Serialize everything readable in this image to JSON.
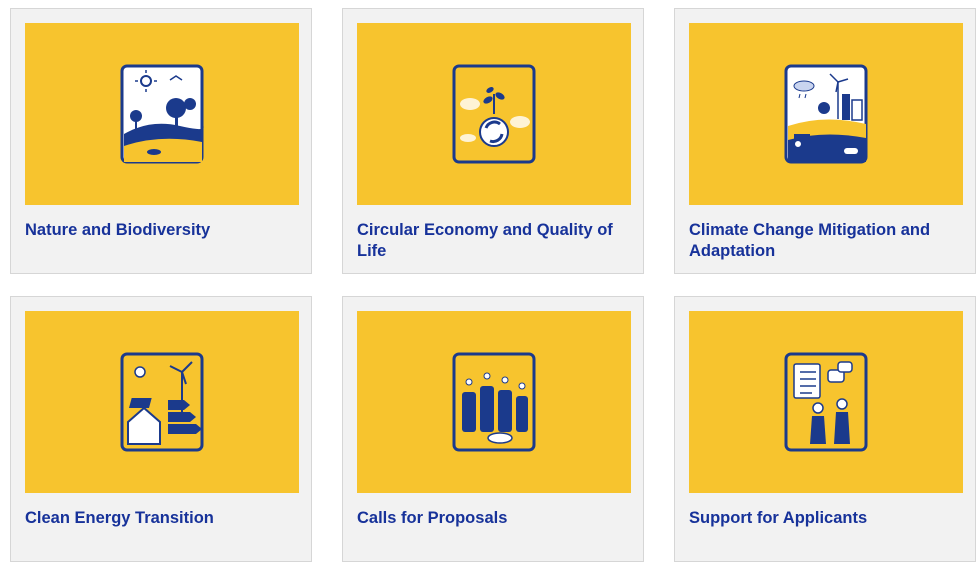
{
  "cards": [
    {
      "title": "Nature and Biodiversity",
      "icon": "nature-biodiversity-icon"
    },
    {
      "title": "Circular Economy and Quality of Life",
      "icon": "circular-economy-icon"
    },
    {
      "title": "Climate Change Mitigation and Adaptation",
      "icon": "climate-change-icon"
    },
    {
      "title": "Clean Energy Transition",
      "icon": "clean-energy-icon"
    },
    {
      "title": "Calls for Proposals",
      "icon": "coins-growth-icon"
    },
    {
      "title": "Support for Applicants",
      "icon": "support-applicants-icon"
    }
  ],
  "colors": {
    "accent_yellow": "#f7c42e",
    "title_blue": "#17329a",
    "icon_navy": "#1b3a8c",
    "card_bg": "#f2f2f2"
  }
}
